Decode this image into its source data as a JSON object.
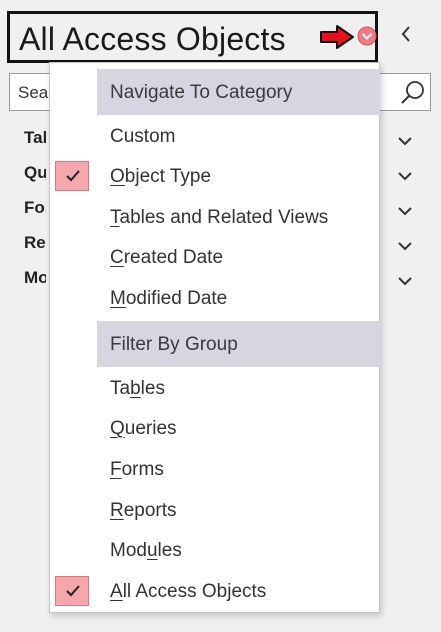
{
  "header": {
    "title": "All Access Objects"
  },
  "search": {
    "placeholder": "Search..."
  },
  "groups": [
    {
      "label": "Tables"
    },
    {
      "label": "Queries"
    },
    {
      "label": "Forms"
    },
    {
      "label": "Reports"
    },
    {
      "label": "Modules"
    }
  ],
  "menu": {
    "navigate_header": "Navigate To Category",
    "navigate_items": [
      {
        "label": "Custom",
        "checked": false
      },
      {
        "label": "Object Type",
        "checked": true,
        "access_key": "O"
      },
      {
        "label": "Tables and Related Views",
        "checked": false,
        "access_key": "T"
      },
      {
        "label": "Created Date",
        "checked": false,
        "access_key": "C"
      },
      {
        "label": "Modified Date",
        "checked": false,
        "access_key": "M"
      }
    ],
    "filter_header": "Filter By Group",
    "filter_items": [
      {
        "label": "Tables",
        "checked": false,
        "access_key": "b"
      },
      {
        "label": "Queries",
        "checked": false,
        "access_key": "Q"
      },
      {
        "label": "Forms",
        "checked": false,
        "access_key": "F"
      },
      {
        "label": "Reports",
        "checked": false,
        "access_key": "R"
      },
      {
        "label": "Modules",
        "checked": false,
        "access_key": "u"
      },
      {
        "label": "All Access Objects",
        "checked": true,
        "access_key": "A"
      }
    ]
  },
  "colors": {
    "menu_header_bg": "#d6d6e2",
    "check_bg": "#f6a6ad",
    "arrow_red": "#e8101c",
    "dropdown_circle": "#f07a86"
  }
}
